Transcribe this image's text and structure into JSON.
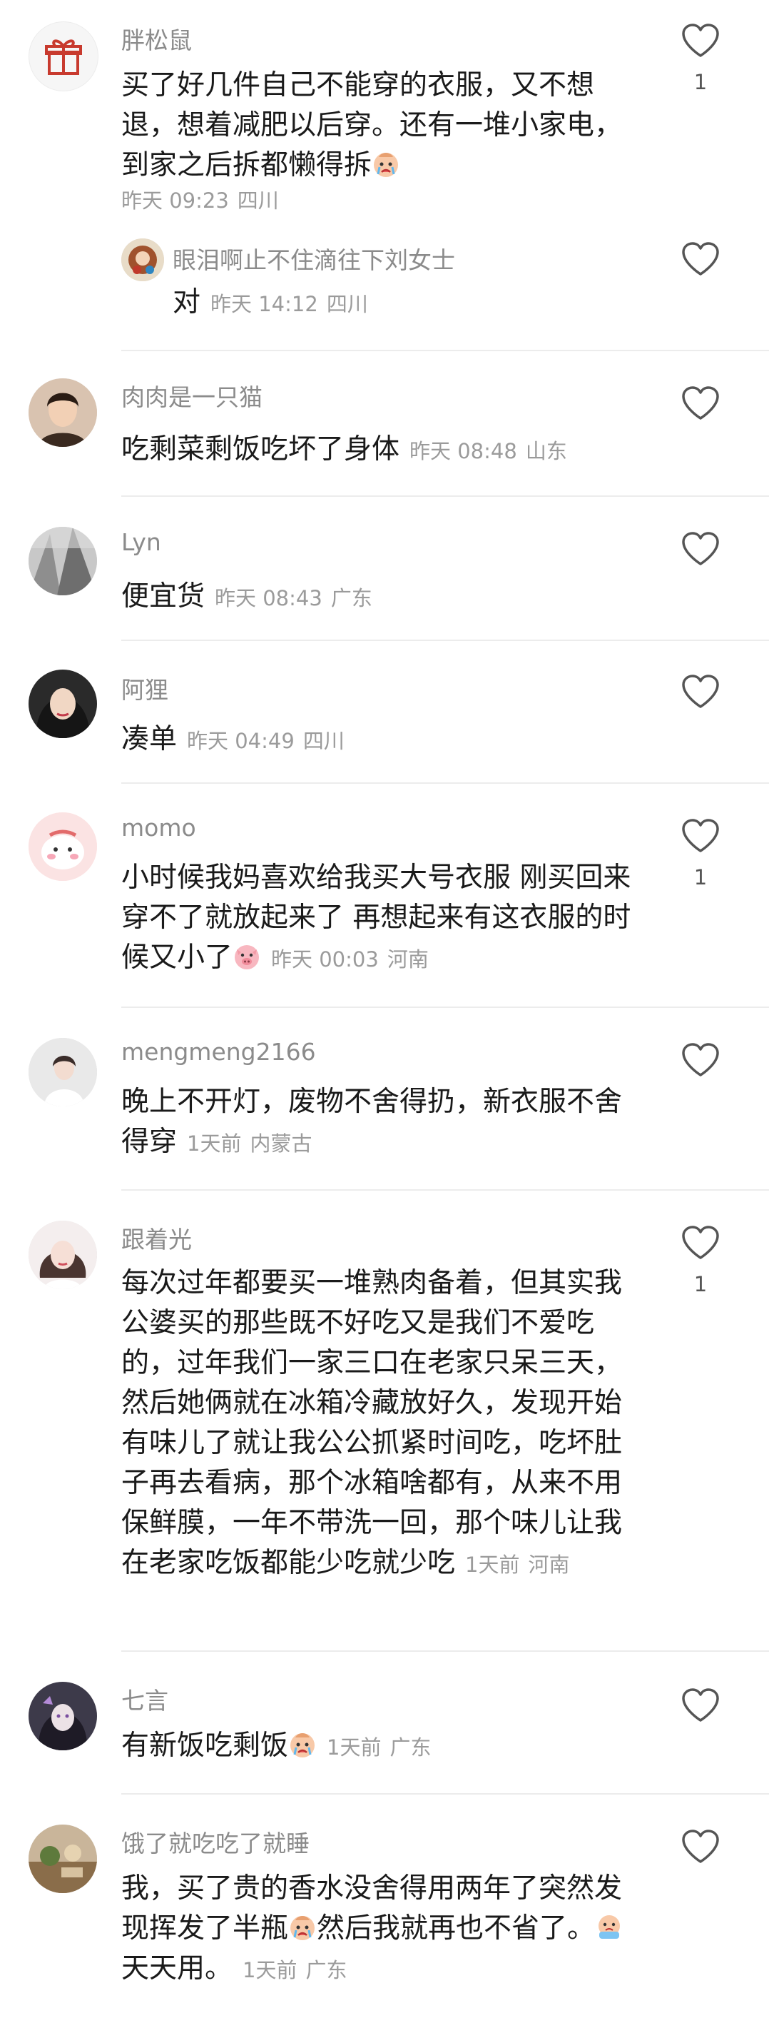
{
  "comments": [
    {
      "name": "胖松鼠",
      "text": "买了好几件自己不能穿的衣服，又不想退，想着减肥以后穿。还有一堆小家电，到家之后拆都懒得拆",
      "emoji": "crying-face-emoji",
      "time": "昨天 09:23",
      "location": "四川",
      "likes": "1",
      "avatar_icon": "gift-icon",
      "reply": {
        "name": "眼泪啊止不住滴往下刘女士",
        "text": "对",
        "time": "昨天 14:12",
        "location": "四川"
      }
    },
    {
      "name": "肉肉是一只猫",
      "text": "吃剩菜剩饭吃坏了身体",
      "time": "昨天 08:48",
      "location": "山东",
      "likes": ""
    },
    {
      "name": "Lyn",
      "text": "便宜货",
      "time": "昨天 08:43",
      "location": "广东",
      "likes": ""
    },
    {
      "name": "阿狸",
      "text": "凑单",
      "time": "昨天 04:49",
      "location": "四川",
      "likes": ""
    },
    {
      "name": "momo",
      "text": "小时候我妈喜欢给我买大号衣服 刚买回来穿不了就放起来了 再想起来有这衣服的时候又小了",
      "emoji": "pig-face-emoji",
      "time": "昨天 00:03",
      "location": "河南",
      "likes": "1"
    },
    {
      "name": "mengmeng2166",
      "text": "晚上不开灯，废物不舍得扔，新衣服不舍得穿",
      "time": "1天前",
      "location": "内蒙古",
      "likes": ""
    },
    {
      "name": "跟着光",
      "text": "每次过年都要买一堆熟肉备着，但其实我公婆买的那些既不好吃又是我们不爱吃的，过年我们一家三口在老家只呆三天，然后她俩就在冰箱冷藏放好久，发现开始有味儿了就让我公公抓紧时间吃，吃坏肚子再去看病，那个冰箱啥都有，从来不用保鲜膜，一年不带洗一回，那个味儿让我在老家吃饭都能少吃就少吃",
      "time": "1天前",
      "location": "河南",
      "likes": "1"
    },
    {
      "name": "七言",
      "text": "有新饭吃剩饭",
      "emoji": "crying-face-emoji",
      "time": "1天前",
      "location": "广东",
      "likes": ""
    },
    {
      "name": "饿了就吃吃了就睡",
      "text": "我，买了贵的香水没舍得用两年了突然发现挥发了半瓶",
      "emoji": "crying-face-emoji",
      "text2": "然后我就再也不省了。",
      "emoji2": "crying-tears-emoji",
      "text3": "天天用。",
      "time": "1天前",
      "location": "广东",
      "likes": ""
    }
  ]
}
